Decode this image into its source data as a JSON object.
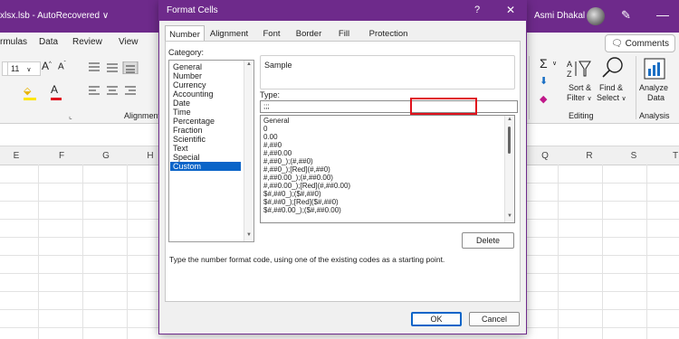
{
  "excel": {
    "file_name": "xlsx.lsb  -  AutoRecovered  ∨",
    "user_name": "Asmi Dhakal",
    "menu_tabs": [
      "rmulas",
      "Data",
      "Review",
      "View"
    ],
    "comments_label": "Comments",
    "font_size": "11",
    "ribbon": {
      "alignment_label": "Alignment",
      "sort_filter_label": "Sort &",
      "sort_filter_label2": "Filter",
      "find_select_label": "Find &",
      "find_select_label2": "Select",
      "editing_label": "Editing",
      "analyze_label1": "Analyze",
      "analyze_label2": "Data",
      "analysis_label": "Analysis"
    },
    "columns_left": [
      "E",
      "F",
      "G",
      "H"
    ],
    "columns_right": [
      "Q",
      "R",
      "S",
      "T"
    ]
  },
  "dialog": {
    "title": "Format Cells",
    "help": "?",
    "close": "✕",
    "tabs": [
      "Number",
      "Alignment",
      "Font",
      "Border",
      "Fill",
      "Protection"
    ],
    "category_label": "Category:",
    "categories": [
      "General",
      "Number",
      "Currency",
      "Accounting",
      "Date",
      "Time",
      "Percentage",
      "Fraction",
      "Scientific",
      "Text",
      "Special",
      "Custom"
    ],
    "selected_category": "Custom",
    "sample_label": "Sample",
    "type_label": "Type:",
    "type_value": ";;;",
    "formats": [
      "General",
      "0",
      "0.00",
      "#,##0",
      "#,##0.00",
      "#,##0_);(#,##0)",
      "#,##0_);[Red](#,##0)",
      "#,##0.00_);(#,##0.00)",
      "#,##0.00_);[Red](#,##0.00)",
      "$#,##0_);($#,##0)",
      "$#,##0_);[Red]($#,##0)",
      "$#,##0.00_);($#,##0.00)"
    ],
    "delete_label": "Delete",
    "hint": "Type the number format code, using one of the existing codes as a starting point.",
    "ok_label": "OK",
    "cancel_label": "Cancel"
  },
  "colors": {
    "accent_purple": "#6e2a8b",
    "selection_blue": "#0a64c8",
    "highlight_red": "#e0121d"
  }
}
